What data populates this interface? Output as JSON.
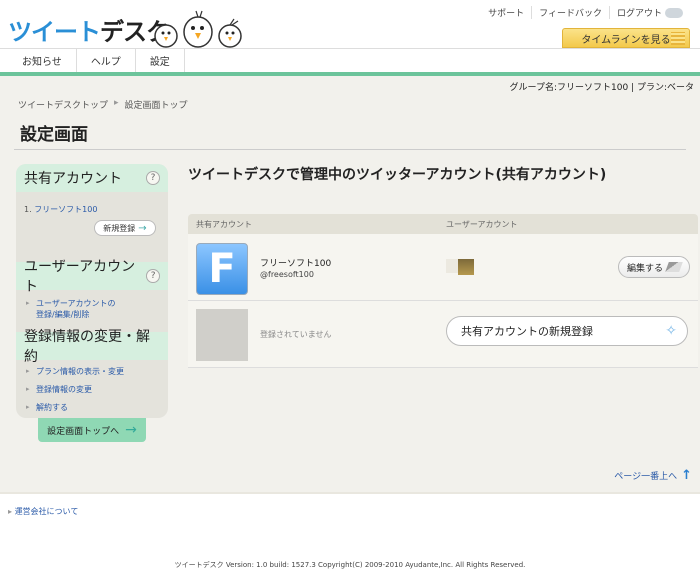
{
  "header": {
    "logo_part1": "ツイート",
    "logo_part2": "デスク",
    "links": [
      "サポート",
      "フィードバック",
      "ログアウト"
    ],
    "timeline_button": "タイムラインを見る"
  },
  "nav": {
    "items": [
      "お知らせ",
      "ヘルプ",
      "設定"
    ]
  },
  "group_info": "グループ名:フリーソフト100 | プラン:ベータ",
  "breadcrumb": {
    "home": "ツイートデスクトップ",
    "current": "設定画面トップ"
  },
  "page_title": "設定画面",
  "sidebar": {
    "shared_heading": "共有アカウント",
    "account_number": "1.",
    "account_name": "フリーソフト100",
    "new_register": "新規登録",
    "user_heading": "ユーザーアカウント",
    "user_link_line1": "ユーザーアカウントの",
    "user_link_line2": "登録/編集/削除",
    "reg_heading": "登録情報の変更・解約",
    "reg_links": [
      "プラン情報の表示・変更",
      "登録情報の変更",
      "解約する"
    ],
    "help_icon": "?"
  },
  "top_button": "設定画面トップへ",
  "content": {
    "title": "ツイートデスクで管理中のツイッターアカウント(共有アカウント)",
    "col_shared": "共有アカウント",
    "col_user": "ユーザーアカウント",
    "rows": [
      {
        "name": "フリーソフト100",
        "handle": "@freesoft100",
        "avatar_letter": "F",
        "action": "編集する"
      },
      {
        "status": "登録されていません",
        "action": "共有アカウントの新規登録"
      }
    ]
  },
  "page_top": "ページ一番上へ",
  "footer": {
    "company": "運営会社について",
    "copyright": "ツイートデスク Version: 1.0 build: 1527.3 Copyright(C) 2009-2010 Ayudante,Inc. All Rights Reserved."
  }
}
